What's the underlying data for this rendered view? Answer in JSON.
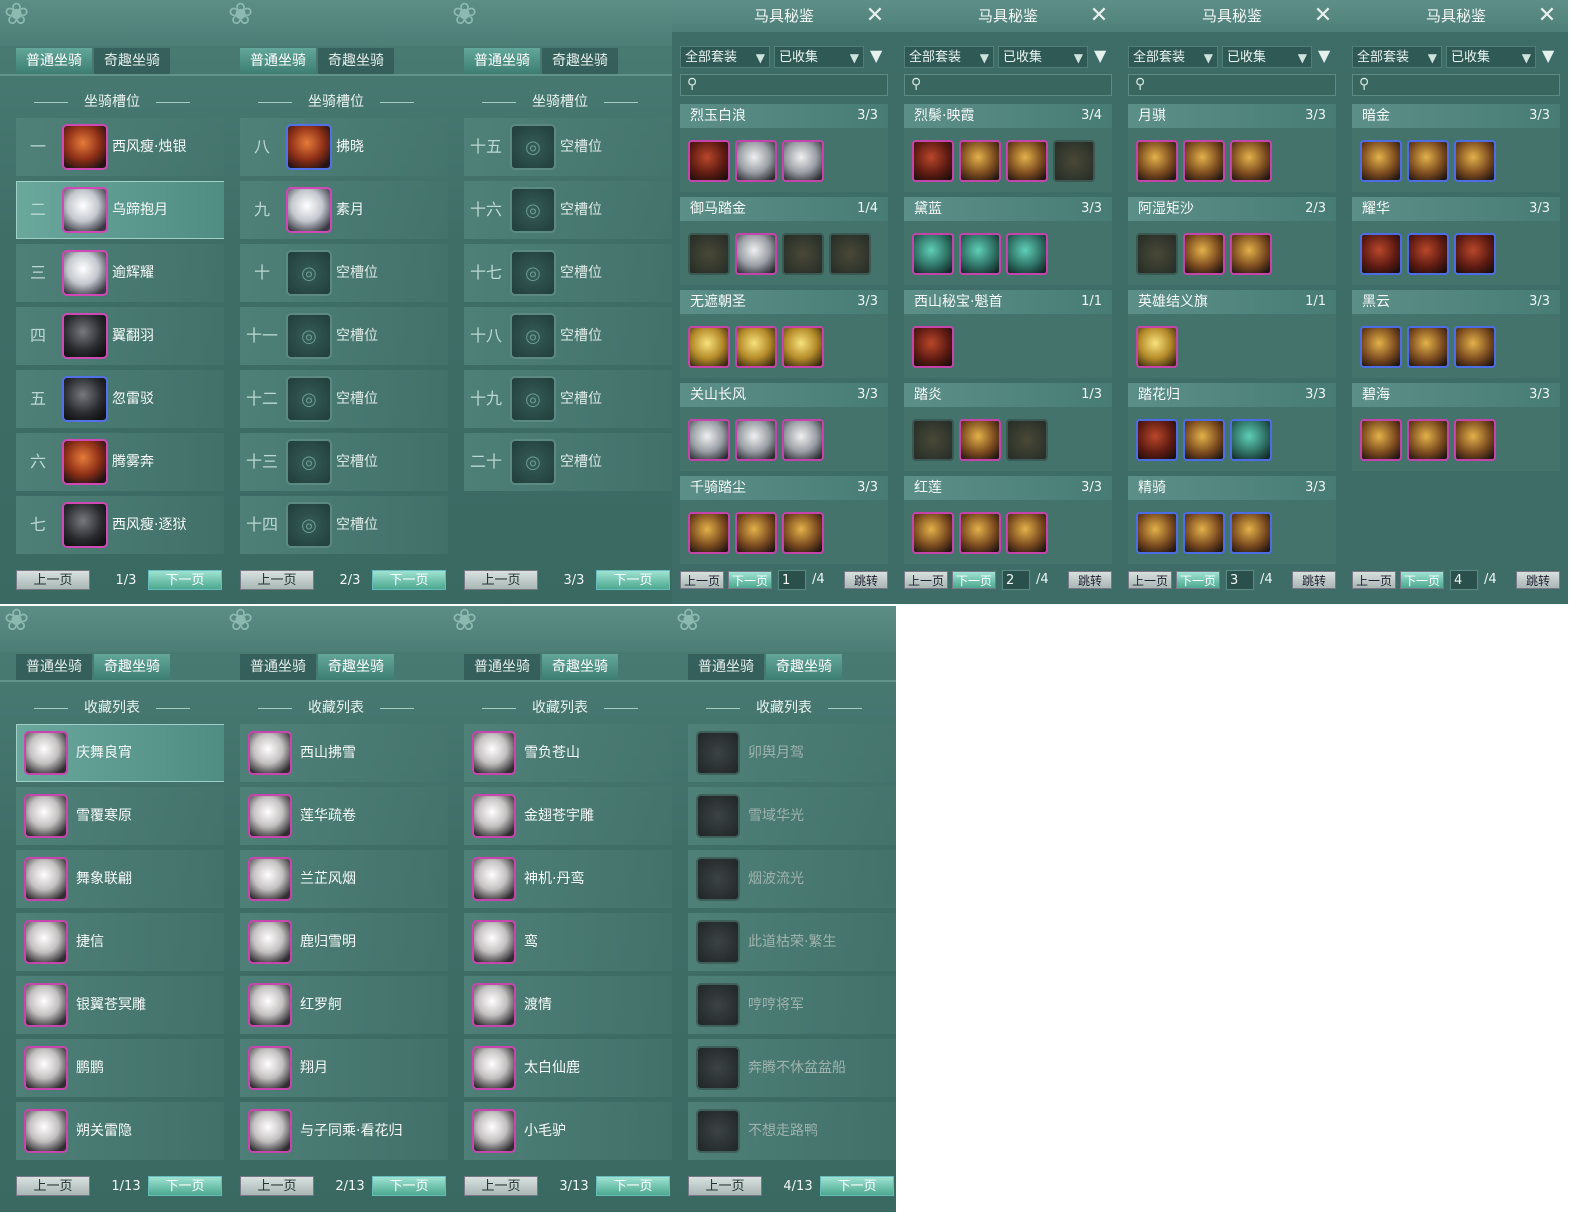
{
  "tabs": {
    "normal": "普通坐骑",
    "fun": "奇趣坐骑"
  },
  "slot_header": "坐骑槽位",
  "collection_header": "收藏列表",
  "pager": {
    "prev": "上一页",
    "next": "下一页"
  },
  "slot_panels": [
    {
      "page": "1/3",
      "rows": [
        {
          "num": "一",
          "name": "西风瘦·烛银",
          "style": "orange",
          "frame": "pink"
        },
        {
          "num": "二",
          "name": "乌蹄抱月",
          "style": "white",
          "frame": "pink",
          "selected": true
        },
        {
          "num": "三",
          "name": "逾辉耀",
          "style": "white",
          "frame": "pink"
        },
        {
          "num": "四",
          "name": "翼翻羽",
          "style": "dark",
          "frame": "pink"
        },
        {
          "num": "五",
          "name": "忽雷驳",
          "style": "dark",
          "frame": "blue"
        },
        {
          "num": "六",
          "name": "腾雾奔",
          "style": "orange",
          "frame": "pink"
        },
        {
          "num": "七",
          "name": "西风瘦·逐狱",
          "style": "dark",
          "frame": "pink"
        }
      ]
    },
    {
      "page": "2/3",
      "rows": [
        {
          "num": "八",
          "name": "拂晓",
          "style": "orange",
          "frame": "blue"
        },
        {
          "num": "九",
          "name": "素月",
          "style": "white",
          "frame": "pink"
        },
        {
          "num": "十",
          "name": "空槽位",
          "style": "empty"
        },
        {
          "num": "十一",
          "name": "空槽位",
          "style": "empty"
        },
        {
          "num": "十二",
          "name": "空槽位",
          "style": "empty"
        },
        {
          "num": "十三",
          "name": "空槽位",
          "style": "empty"
        },
        {
          "num": "十四",
          "name": "空槽位",
          "style": "empty"
        }
      ]
    },
    {
      "page": "3/3",
      "rows": [
        {
          "num": "十五",
          "name": "空槽位",
          "style": "empty"
        },
        {
          "num": "十六",
          "name": "空槽位",
          "style": "empty"
        },
        {
          "num": "十七",
          "name": "空槽位",
          "style": "empty"
        },
        {
          "num": "十八",
          "name": "空槽位",
          "style": "empty"
        },
        {
          "num": "十九",
          "name": "空槽位",
          "style": "empty"
        },
        {
          "num": "二十",
          "name": "空槽位",
          "style": "empty"
        }
      ]
    }
  ],
  "tack": {
    "title": "马具秘鉴",
    "filter_all": "全部套装",
    "filter_collected": "已收集",
    "jump": "跳转",
    "total": "/4",
    "pages": [
      {
        "page": "1",
        "sets": [
          {
            "name": "烈玉白浪",
            "count": "3/3",
            "items": [
              "r",
              "g",
              "g"
            ]
          },
          {
            "name": "御马踏金",
            "count": "1/4",
            "items": [
              "none",
              "g",
              "none",
              "none"
            ]
          },
          {
            "name": "无遮朝圣",
            "count": "3/3",
            "items": [
              "y",
              "y",
              "y"
            ]
          },
          {
            "name": "关山长风",
            "count": "3/3",
            "items": [
              "g",
              "g",
              "g"
            ]
          },
          {
            "name": "千骑踏尘",
            "count": "3/3",
            "items": [
              "n",
              "n",
              "n"
            ]
          }
        ]
      },
      {
        "page": "2",
        "sets": [
          {
            "name": "烈鬃·映霞",
            "count": "3/4",
            "items": [
              "r",
              "n",
              "n",
              "none"
            ]
          },
          {
            "name": "黛蓝",
            "count": "3/3",
            "items": [
              "t",
              "t",
              "t"
            ]
          },
          {
            "name": "西山秘宝·魁首",
            "count": "1/1",
            "items": [
              "r"
            ]
          },
          {
            "name": "踏炎",
            "count": "1/3",
            "items": [
              "none",
              "n",
              "none"
            ]
          },
          {
            "name": "红莲",
            "count": "3/3",
            "items": [
              "n",
              "n",
              "n"
            ]
          }
        ]
      },
      {
        "page": "3",
        "sets": [
          {
            "name": "月骐",
            "count": "3/3",
            "items": [
              "n",
              "n",
              "n"
            ]
          },
          {
            "name": "阿湿矩沙",
            "count": "2/3",
            "items": [
              "none",
              "n",
              "n"
            ]
          },
          {
            "name": "英雄结义旗",
            "count": "1/1",
            "items": [
              "y"
            ]
          },
          {
            "name": "踏花归",
            "count": "3/3",
            "items": [
              "rb",
              "nb",
              "tb"
            ]
          },
          {
            "name": "精骑",
            "count": "3/3",
            "items": [
              "nb",
              "nb",
              "nb"
            ]
          }
        ]
      },
      {
        "page": "4",
        "sets": [
          {
            "name": "暗金",
            "count": "3/3",
            "items": [
              "nb",
              "nb",
              "nb"
            ]
          },
          {
            "name": "耀华",
            "count": "3/3",
            "items": [
              "rb",
              "rb",
              "rb"
            ]
          },
          {
            "name": "黑云",
            "count": "3/3",
            "items": [
              "nb",
              "nb",
              "nb"
            ]
          },
          {
            "name": "碧海",
            "count": "3/3",
            "items": [
              "n",
              "n",
              "n"
            ]
          }
        ]
      }
    ]
  },
  "collection_panels": [
    {
      "page": "1/13",
      "items": [
        {
          "name": "庆舞良宵",
          "selected": true
        },
        {
          "name": "雪覆寒原"
        },
        {
          "name": "舞象联翩"
        },
        {
          "name": "捷信"
        },
        {
          "name": "银翼苍冥雕"
        },
        {
          "name": "鹏鹏"
        },
        {
          "name": "朔关雷隐"
        }
      ]
    },
    {
      "page": "2/13",
      "items": [
        {
          "name": "西山拂雪"
        },
        {
          "name": "莲华疏卷"
        },
        {
          "name": "兰芷风烟"
        },
        {
          "name": "鹿归雪明"
        },
        {
          "name": "红罗舸"
        },
        {
          "name": "翔月"
        },
        {
          "name": "与子同乘·看花归"
        }
      ]
    },
    {
      "page": "3/13",
      "items": [
        {
          "name": "雪负苍山"
        },
        {
          "name": "金翅苍宇雕"
        },
        {
          "name": "神机·丹鸾"
        },
        {
          "name": "鸾"
        },
        {
          "name": "渡情"
        },
        {
          "name": "太白仙鹿"
        },
        {
          "name": "小毛驴"
        }
      ]
    },
    {
      "page": "4/13",
      "items": [
        {
          "name": "卯舆月驾",
          "dim": true
        },
        {
          "name": "雪域华光",
          "dim": true
        },
        {
          "name": "烟波流光",
          "dim": true
        },
        {
          "name": "此道枯荣·繁生",
          "dim": true
        },
        {
          "name": "哼哼将军",
          "dim": true
        },
        {
          "name": "奔腾不休盆盆船",
          "dim": true
        },
        {
          "name": "不想走路鸭",
          "dim": true
        }
      ]
    }
  ],
  "icons": {
    "horse": "horse-icon",
    "empty": "empty-slot-icon",
    "close": "close-icon",
    "search": "search-icon",
    "filter": "filter-icon"
  }
}
